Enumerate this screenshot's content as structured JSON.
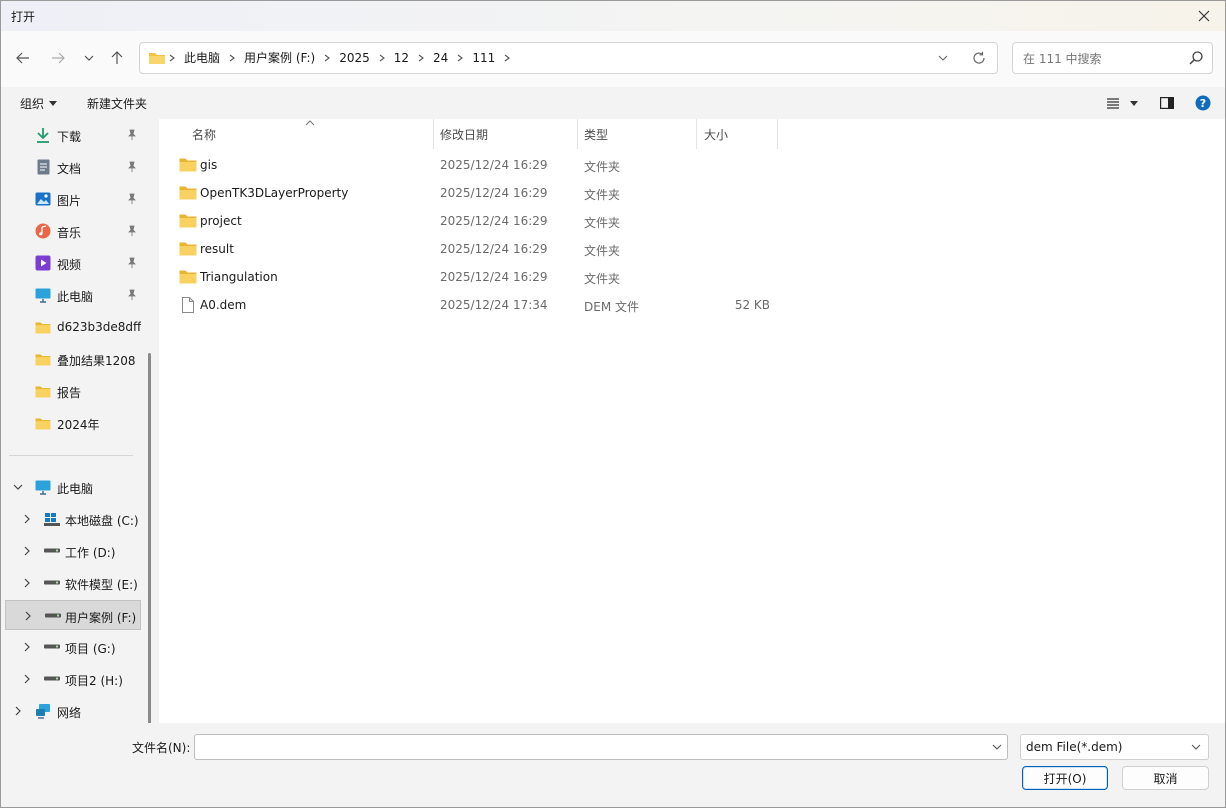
{
  "window": {
    "title": "打开",
    "close_icon": "close-icon"
  },
  "nav": {
    "back_icon": "arrow-left-icon",
    "forward_icon": "arrow-right-icon",
    "recent_icon": "chevron-down-icon",
    "up_icon": "arrow-up-icon"
  },
  "address": {
    "crumbs": [
      "此电脑",
      "用户案例 (F:)",
      "2025",
      "12",
      "24",
      "111"
    ]
  },
  "search": {
    "placeholder": "在 111 中搜索"
  },
  "toolbar": {
    "organize": "组织",
    "new_folder": "新建文件夹"
  },
  "sidebar": {
    "quick": [
      {
        "label": "下载",
        "icon": "download-icon",
        "pinned": true
      },
      {
        "label": "文档",
        "icon": "document-icon",
        "pinned": true
      },
      {
        "label": "图片",
        "icon": "pictures-icon",
        "pinned": true
      },
      {
        "label": "音乐",
        "icon": "music-icon",
        "pinned": true
      },
      {
        "label": "视频",
        "icon": "video-icon",
        "pinned": true
      },
      {
        "label": "此电脑",
        "icon": "computer-icon",
        "pinned": true
      },
      {
        "label": "d623b3de8dff",
        "icon": "folder-icon",
        "pinned": false
      },
      {
        "label": "叠加结果1208",
        "icon": "folder-icon",
        "pinned": false
      },
      {
        "label": "报告",
        "icon": "folder-icon",
        "pinned": false
      },
      {
        "label": "2024年",
        "icon": "folder-icon",
        "pinned": false
      }
    ],
    "tree_root": "此电脑",
    "drives": [
      {
        "label": "本地磁盘 (C:)",
        "icon": "windows-drive-icon"
      },
      {
        "label": "工作 (D:)",
        "icon": "drive-icon"
      },
      {
        "label": "软件模型 (E:)",
        "icon": "drive-icon"
      },
      {
        "label": "用户案例 (F:)",
        "icon": "drive-icon",
        "selected": true
      },
      {
        "label": "项目 (G:)",
        "icon": "drive-icon"
      },
      {
        "label": "项目2 (H:)",
        "icon": "drive-icon"
      }
    ],
    "network": "网络"
  },
  "columns": {
    "name": "名称",
    "modified": "修改日期",
    "type": "类型",
    "size": "大小"
  },
  "files": [
    {
      "name": "gis",
      "modified": "2025/12/24 16:29",
      "type": "文件夹",
      "size": "",
      "kind": "folder"
    },
    {
      "name": "OpenTK3DLayerProperty",
      "modified": "2025/12/24 16:29",
      "type": "文件夹",
      "size": "",
      "kind": "folder"
    },
    {
      "name": "project",
      "modified": "2025/12/24 16:29",
      "type": "文件夹",
      "size": "",
      "kind": "folder"
    },
    {
      "name": "result",
      "modified": "2025/12/24 16:29",
      "type": "文件夹",
      "size": "",
      "kind": "folder"
    },
    {
      "name": "Triangulation",
      "modified": "2025/12/24 16:29",
      "type": "文件夹",
      "size": "",
      "kind": "folder"
    },
    {
      "name": "A0.dem",
      "modified": "2025/12/24 17:34",
      "type": "DEM 文件",
      "size": "52 KB",
      "kind": "file"
    }
  ],
  "bottom": {
    "filename_label": "文件名(N):",
    "filename_value": "",
    "filter": "dem File(*.dem)",
    "open": "打开(O)",
    "cancel": "取消"
  },
  "colors": {
    "accent": "#005fb8",
    "folder": "#f5c342",
    "help": "#0f6cbd"
  }
}
